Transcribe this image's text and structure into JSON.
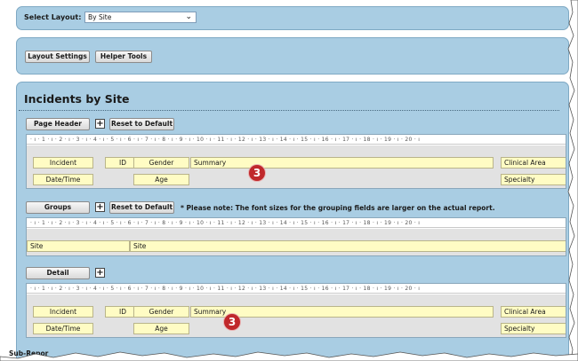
{
  "layout_bar": {
    "label": "Select Layout:",
    "selected": "By Site"
  },
  "tools": {
    "layout_settings": "Layout Settings",
    "helper_tools": "Helper Tools"
  },
  "incidents": {
    "title": "Incidents by Site",
    "ruler": "· ı · 1 · ı · 2 · ı · 3 · ı · 4 · ı · 5 · ı · 6 · ı · 7 · ı · 8 · ı · 9 · ı · 10 · ı · 11 · ı · 12 · ı · 13 · ı · 14 · ı · 15 · ı · 16 · ı · 17 · ı · 18 · ı · 19 · ı · 20 · ı",
    "page_header": {
      "button": "Page Header",
      "reset": "Reset to Default",
      "row1": [
        "Incident",
        "ID",
        "Gender",
        "Summary",
        "Clinical Area"
      ],
      "row2": [
        "Date/Time",
        "Age",
        "Specialty"
      ],
      "badge": "3"
    },
    "groups": {
      "button": "Groups",
      "reset": "Reset to Default",
      "note": "* Please note: The font sizes for the grouping fields are larger on the actual report.",
      "row": [
        "Site",
        "Site"
      ]
    },
    "detail": {
      "button": "Detail",
      "row1": [
        "Incident",
        "ID",
        "Gender",
        "Summary",
        "Clinical Area"
      ],
      "row2": [
        "Date/Time",
        "Age",
        "Specialty"
      ],
      "badge": "3"
    },
    "subreport": "Sub-Repor"
  },
  "icons": {
    "expand": "plus-box",
    "dropdown": "chevron-down"
  },
  "colors": {
    "panel": "#a9cde3",
    "field": "#fffcc4",
    "badge": "#c0282b"
  }
}
